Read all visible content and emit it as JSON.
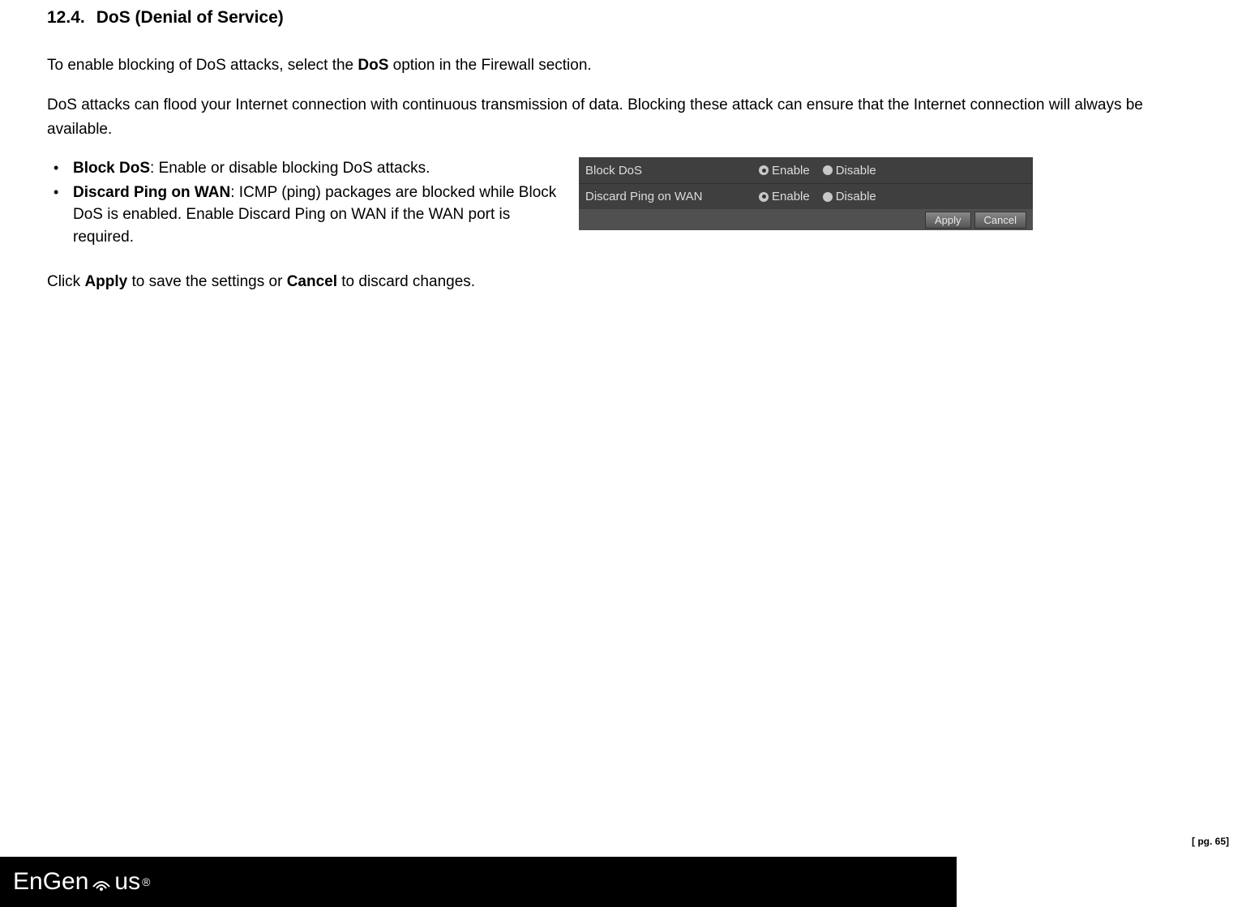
{
  "heading": {
    "number": "12.4.",
    "title": "DoS (Denial of Service)"
  },
  "intro_para_pre": "To enable blocking of DoS attacks, select the ",
  "intro_para_bold": "DoS",
  "intro_para_post": " option in the Firewall section.",
  "desc_para": "DoS attacks can flood your Internet connection with continuous transmission of data. Blocking these attack can ensure that the Internet connection will always be available.",
  "bullets": [
    {
      "term": "Block DoS",
      "text": ": Enable or disable blocking DoS attacks."
    },
    {
      "term": "Discard Ping on WAN",
      "text": ": ICMP (ping) packages are blocked while Block DoS is enabled. Enable Discard Ping on WAN if the WAN port is required."
    }
  ],
  "closing_pre": "Click ",
  "closing_b1": "Apply",
  "closing_mid": " to save the settings or ",
  "closing_b2": "Cancel",
  "closing_post": " to discard changes.",
  "panel": {
    "row1_label": "Block DoS",
    "row2_label": "Discard Ping on WAN",
    "opt_enable": "Enable",
    "opt_disable": "Disable",
    "btn_apply": "Apply",
    "btn_cancel": "Cancel"
  },
  "footer": {
    "page_number": "[ pg. 65]",
    "logo_pre": "EnGen",
    "logo_post": "us",
    "logo_reg": "®"
  }
}
